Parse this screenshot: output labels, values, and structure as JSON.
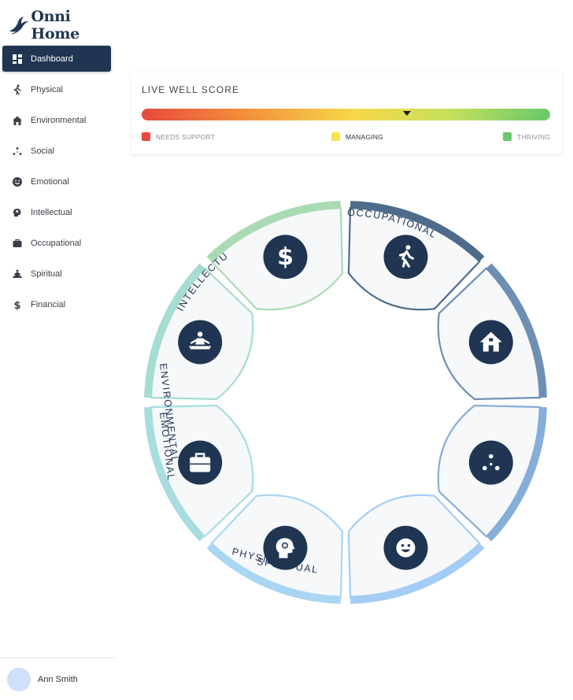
{
  "app": {
    "name": "Onni Home"
  },
  "sidebar": {
    "items": [
      {
        "label": "Dashboard",
        "icon": "dashboard-icon",
        "active": true
      },
      {
        "label": "Physical",
        "icon": "walking-icon"
      },
      {
        "label": "Environmental",
        "icon": "home-icon"
      },
      {
        "label": "Social",
        "icon": "social-dots-icon"
      },
      {
        "label": "Emotional",
        "icon": "smile-icon"
      },
      {
        "label": "Intellectual",
        "icon": "brain-head-icon"
      },
      {
        "label": "Occupational",
        "icon": "briefcase-icon"
      },
      {
        "label": "Spiritual",
        "icon": "meditation-icon"
      },
      {
        "label": "Financial",
        "icon": "dollar-icon"
      }
    ]
  },
  "user": {
    "name": "Ann Smith"
  },
  "score": {
    "title": "LIVE WELL SCORE",
    "value_fraction": 0.65,
    "legend": [
      {
        "label": "NEEDS SUPPORT",
        "color": "#e8493c"
      },
      {
        "label": "MANAGING",
        "color": "#f6e44a"
      },
      {
        "label": "THRIVING",
        "color": "#67c96a"
      }
    ]
  },
  "wheel": {
    "segments": [
      {
        "key": "physical",
        "label": "",
        "icon": "walking-icon",
        "color": "#4d6b8a"
      },
      {
        "key": "environmental",
        "label": "",
        "icon": "home-icon",
        "color": "#6d8fb3"
      },
      {
        "key": "social",
        "label": "",
        "icon": "social-dots-icon",
        "color": "#86aed8"
      },
      {
        "key": "emotional",
        "label": "",
        "icon": "smile-icon",
        "color": "#a3cdf5"
      },
      {
        "key": "intellectual",
        "label": "",
        "icon": "brain-head-icon",
        "color": "#a9d6f2"
      },
      {
        "key": "occupational",
        "label": "",
        "icon": "briefcase-icon",
        "color": "#a8dde0"
      },
      {
        "key": "spiritual",
        "label": "",
        "icon": "meditation-icon",
        "color": "#a6ddd2"
      },
      {
        "key": "financial",
        "label": "",
        "icon": "dollar-icon",
        "color": "#a8dbb4"
      }
    ],
    "labels": [
      "OCCUPATIONAL",
      "INTELLECTUAL",
      "ENVIRONMENTAL",
      "EMOTIONAL",
      "PHYSICAL",
      "SPIRITUAL"
    ]
  }
}
